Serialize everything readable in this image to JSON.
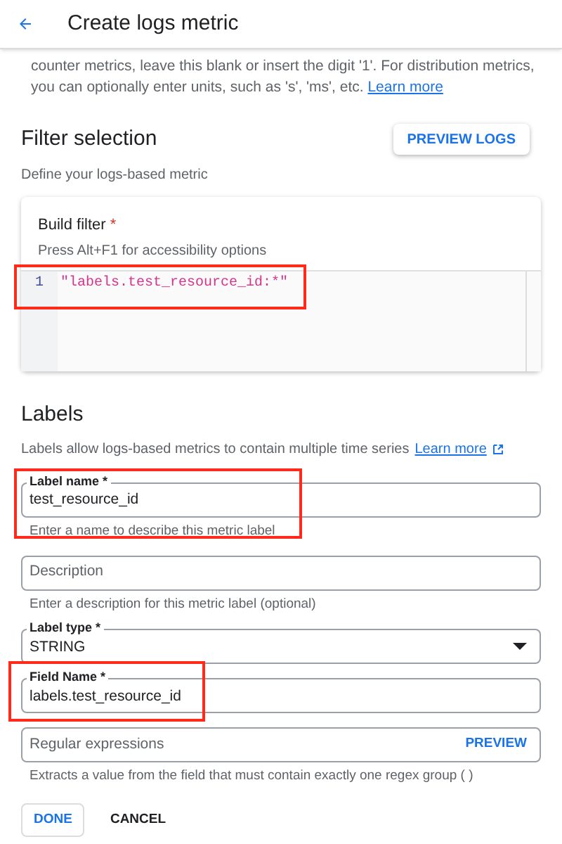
{
  "header": {
    "title": "Create logs metric"
  },
  "intro": {
    "text": "counter metrics, leave this blank or insert the digit '1'. For distribution metrics, you can optionally enter units, such as 's', 'ms', etc.",
    "link": "Learn more"
  },
  "filter": {
    "title": "Filter selection",
    "button": "PREVIEW LOGS",
    "description": "Define your logs-based metric",
    "editor": {
      "label": "Build filter",
      "required_mark": "*",
      "hint": "Press Alt+F1 for accessibility options",
      "highlighted": true,
      "lines": [
        {
          "number": "1",
          "code": "\"labels.test_resource_id:*\""
        }
      ]
    }
  },
  "labels": {
    "title": "Labels",
    "description": "Labels allow logs-based metrics to contain multiple time series",
    "link": "Learn more",
    "fields": [
      {
        "kind": "text",
        "label": "Label name *",
        "value": "test_resource_id",
        "helper": "Enter a name to describe this metric label",
        "highlighted": true
      },
      {
        "kind": "text",
        "placeholder": "Description",
        "helper": "Enter a description for this metric label (optional)",
        "highlighted": false
      },
      {
        "kind": "select",
        "label": "Label type *",
        "value": "STRING",
        "highlighted": false
      },
      {
        "kind": "text",
        "label": "Field Name *",
        "value": "labels.test_resource_id",
        "highlighted": true
      },
      {
        "kind": "action",
        "placeholder": "Regular expressions",
        "action": "PREVIEW",
        "helper": "Extracts a value from the field that must contain exactly one regex group ( )",
        "highlighted": false
      }
    ],
    "buttons": [
      {
        "label": "DONE",
        "kind": "outlined"
      },
      {
        "label": "CANCEL",
        "kind": "text"
      }
    ]
  }
}
